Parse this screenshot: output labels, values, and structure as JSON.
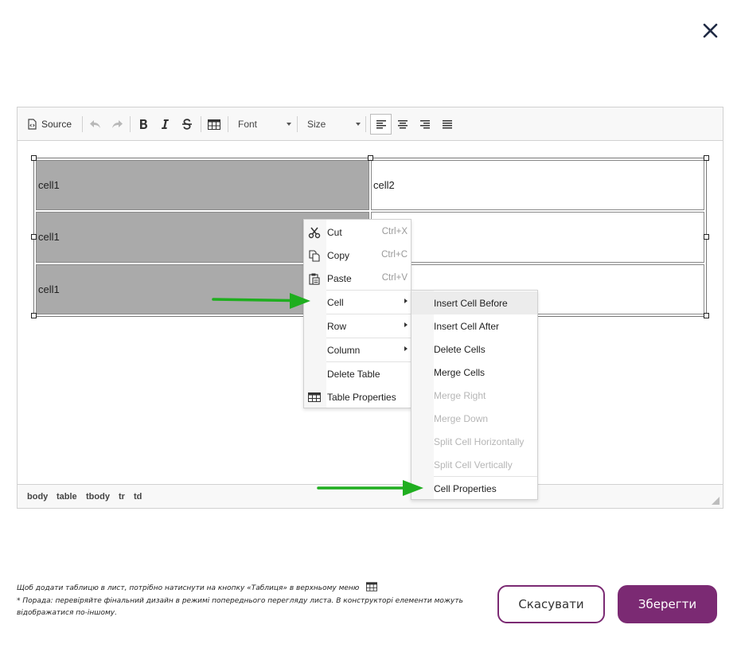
{
  "toolbar": {
    "source_label": "Source",
    "font_label": "Font",
    "size_label": "Size"
  },
  "table": {
    "rows": [
      [
        "cell1",
        "cell2"
      ],
      [
        "cell1",
        ""
      ],
      [
        "cell1",
        ""
      ]
    ]
  },
  "context_menu": {
    "items": [
      {
        "label": "Cut",
        "shortcut": "Ctrl+X",
        "icon": "scissors-icon"
      },
      {
        "label": "Copy",
        "shortcut": "Ctrl+C",
        "icon": "copy-icon"
      },
      {
        "label": "Paste",
        "shortcut": "Ctrl+V",
        "icon": "paste-icon"
      },
      {
        "label": "Cell"
      },
      {
        "label": "Row"
      },
      {
        "label": "Column"
      },
      {
        "label": "Delete Table"
      },
      {
        "label": "Table Properties",
        "icon": "table-icon"
      }
    ]
  },
  "cell_submenu": {
    "items": [
      {
        "label": "Insert Cell Before"
      },
      {
        "label": "Insert Cell After"
      },
      {
        "label": "Delete Cells"
      },
      {
        "label": "Merge Cells"
      },
      {
        "label": "Merge Right"
      },
      {
        "label": "Merge Down"
      },
      {
        "label": "Split Cell Horizontally"
      },
      {
        "label": "Split Cell Vertically"
      },
      {
        "label": "Cell Properties"
      }
    ]
  },
  "path_bar": [
    "body",
    "table",
    "tbody",
    "tr",
    "td"
  ],
  "footer": {
    "note1": "Щоб додати таблицю в лист, потрібно натиснути на кнопку «Таблиця» в верхньому меню",
    "note2a": "* Порада: перевіряйте фінальний дизайн в режимі попереднього перегляду листа. В конструкторі елементи можуть",
    "note2b": "відображатися по-іншому."
  },
  "buttons": {
    "cancel": "Скасувати",
    "save": "Зберегти"
  },
  "colors": {
    "brand": "#7b2a73",
    "selected_cell": "#aaaaaa",
    "annotation_arrow": "#1fae1f"
  }
}
